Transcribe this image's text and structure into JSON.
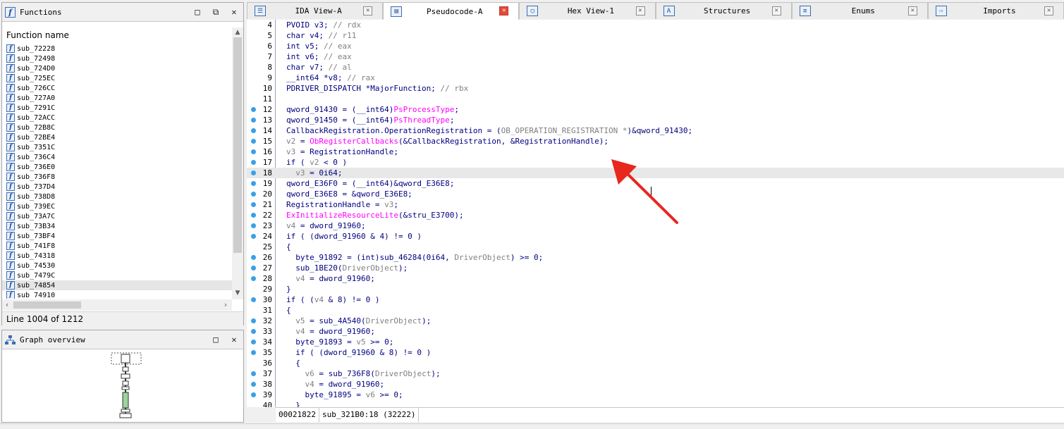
{
  "functions_panel": {
    "title": "Functions",
    "column_header": "Function name",
    "items": [
      "sub_72228",
      "sub_72498",
      "sub_724D0",
      "sub_725EC",
      "sub_726CC",
      "sub_727A0",
      "sub_7291C",
      "sub_72ACC",
      "sub_72B8C",
      "sub_72BE4",
      "sub_7351C",
      "sub_736C4",
      "sub_736E0",
      "sub_736F8",
      "sub_737D4",
      "sub_738D8",
      "sub_739EC",
      "sub_73A7C",
      "sub_73B34",
      "sub_73BF4",
      "sub_741F8",
      "sub_74318",
      "sub_74530",
      "sub_7479C",
      "sub_74854",
      "sub_74910"
    ],
    "selected_item": "sub_74854",
    "status": "Line 1004 of 1212"
  },
  "graph_panel": {
    "title": "Graph overview"
  },
  "tabs": [
    {
      "label": "IDA View-A",
      "icon": "disassembly-icon",
      "active": false
    },
    {
      "label": "Pseudocode-A",
      "icon": "pseudocode-icon",
      "active": true
    },
    {
      "label": "Hex View-1",
      "icon": "hex-icon",
      "active": false
    },
    {
      "label": "Structures",
      "icon": "structures-icon",
      "active": false
    },
    {
      "label": "Enums",
      "icon": "enums-icon",
      "active": false
    },
    {
      "label": "Imports",
      "icon": "imports-icon",
      "active": false
    }
  ],
  "code": {
    "current_line": "18",
    "lines": [
      {
        "n": "4",
        "dot": false,
        "html": "PVOID v3; <span class=\"gray\">// rdx</span>"
      },
      {
        "n": "5",
        "dot": false,
        "html": "char v4; <span class=\"gray\">// r11</span>"
      },
      {
        "n": "6",
        "dot": false,
        "html": "int v5; <span class=\"gray\">// eax</span>"
      },
      {
        "n": "7",
        "dot": false,
        "html": "int v6; <span class=\"gray\">// eax</span>"
      },
      {
        "n": "8",
        "dot": false,
        "html": "char v7; <span class=\"gray\">// al</span>"
      },
      {
        "n": "9",
        "dot": false,
        "html": "__int64 *v8; <span class=\"gray\">// rax</span>"
      },
      {
        "n": "10",
        "dot": false,
        "html": "PDRIVER_DISPATCH *MajorFunction; <span class=\"gray\">// rbx</span>"
      },
      {
        "n": "11",
        "dot": false,
        "html": ""
      },
      {
        "n": "12",
        "dot": true,
        "html": "qword_91430 = (__int64)<span class=\"pink\">PsProcessType</span>;"
      },
      {
        "n": "13",
        "dot": true,
        "html": "qword_91450 = (__int64)<span class=\"pink\">PsThreadType</span>;"
      },
      {
        "n": "14",
        "dot": true,
        "html": "CallbackRegistration.OperationRegistration = (<span class=\"gray\">OB_OPERATION_REGISTRATION *</span>)&qword_91430;"
      },
      {
        "n": "15",
        "dot": true,
        "html": "<span class=\"gray\">v2</span> = <span class=\"pink\">ObRegisterCallbacks</span>(&CallbackRegistration, &RegistrationHandle);"
      },
      {
        "n": "16",
        "dot": true,
        "html": "<span class=\"gray\">v3</span> = RegistrationHandle;"
      },
      {
        "n": "17",
        "dot": true,
        "html": "if ( <span class=\"gray\">v2</span> < 0 )"
      },
      {
        "n": "18",
        "dot": true,
        "html": "  <span class=\"gray\">v3</span> = 0i64;"
      },
      {
        "n": "19",
        "dot": true,
        "html": "qword_E36F0 = (__int64)&qword_E36E8;"
      },
      {
        "n": "20",
        "dot": true,
        "html": "qword_E36E8 = &qword_E36E8;"
      },
      {
        "n": "21",
        "dot": true,
        "html": "RegistrationHandle = <span class=\"gray\">v3</span>;"
      },
      {
        "n": "22",
        "dot": true,
        "html": "<span class=\"pink\">ExInitializeResourceLite</span>(&stru_E3700);"
      },
      {
        "n": "23",
        "dot": true,
        "html": "<span class=\"gray\">v4</span> = dword_91960;"
      },
      {
        "n": "24",
        "dot": true,
        "html": "if ( (dword_91960 & 4) != 0 )"
      },
      {
        "n": "25",
        "dot": false,
        "html": "{"
      },
      {
        "n": "26",
        "dot": true,
        "html": "  byte_91892 = (int)sub_46284(0i64, <span class=\"gray\">DriverObject</span>) >= 0;"
      },
      {
        "n": "27",
        "dot": true,
        "html": "  sub_1BE20(<span class=\"gray\">DriverObject</span>);"
      },
      {
        "n": "28",
        "dot": true,
        "html": "  <span class=\"gray\">v4</span> = dword_91960;"
      },
      {
        "n": "29",
        "dot": false,
        "html": "}"
      },
      {
        "n": "30",
        "dot": true,
        "html": "if ( (<span class=\"gray\">v4</span> & 8) != 0 )"
      },
      {
        "n": "31",
        "dot": false,
        "html": "{"
      },
      {
        "n": "32",
        "dot": true,
        "html": "  <span class=\"gray\">v5</span> = sub_4A540(<span class=\"gray\">DriverObject</span>);"
      },
      {
        "n": "33",
        "dot": true,
        "html": "  <span class=\"gray\">v4</span> = dword_91960;"
      },
      {
        "n": "34",
        "dot": true,
        "html": "  byte_91893 = <span class=\"gray\">v5</span> >= 0;"
      },
      {
        "n": "35",
        "dot": true,
        "html": "  if ( (dword_91960 & 8) != 0 )"
      },
      {
        "n": "36",
        "dot": false,
        "html": "  {"
      },
      {
        "n": "37",
        "dot": true,
        "html": "    <span class=\"gray\">v6</span> = sub_736F8(<span class=\"gray\">DriverObject</span>);"
      },
      {
        "n": "38",
        "dot": true,
        "html": "    <span class=\"gray\">v4</span> = dword_91960;"
      },
      {
        "n": "39",
        "dot": true,
        "html": "    byte_91895 = <span class=\"gray\">v6</span> >= 0;"
      },
      {
        "n": "40",
        "dot": false,
        "html": "  }"
      }
    ]
  },
  "status_bar": {
    "address": "00021822",
    "location": "sub_321B0:18 (32222)"
  },
  "colors": {
    "accent_blue": "#3aa0e6",
    "api_pink": "#ff00ff",
    "annotation_arrow": "#e8271e"
  }
}
